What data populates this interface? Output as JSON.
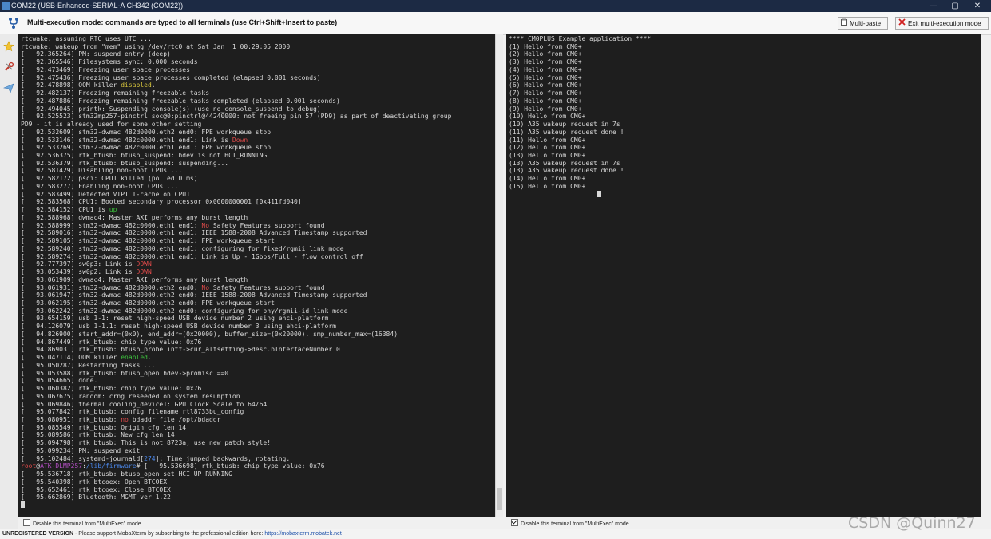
{
  "window": {
    "title": "COM22  (USB-Enhanced-SERIAL-A CH342 (COM22))",
    "minimize_symbol": "—",
    "maximize_symbol": "▢",
    "close_symbol": "✕"
  },
  "banner": {
    "message": "Multi-execution mode: commands are typed to all terminals (use Ctrl+Shift+Insert to paste)",
    "multipaste_label": "Multi-paste",
    "exit_label": "Exit multi-execution mode",
    "icon": "fork-icon"
  },
  "sidebar": {
    "items": [
      {
        "icon": "star-icon"
      },
      {
        "icon": "tools-icon"
      },
      {
        "icon": "send-icon"
      }
    ]
  },
  "left_terminal": {
    "lines": [
      [
        {
          "t": "rtcwake: assuming RTC uses UTC ..."
        }
      ],
      [
        {
          "t": "rtcwake: wakeup from \"mem\" using /dev/rtc0 at Sat Jan  1 00:29:05 2000"
        }
      ],
      [
        {
          "t": "[   92.365264] PM: suspend entry (deep)"
        }
      ],
      [
        {
          "t": "[   92.365546] Filesystems sync: 0.000 seconds"
        }
      ],
      [
        {
          "t": "[   92.473469] Freezing user space processes"
        }
      ],
      [
        {
          "t": "[   92.475436] Freezing user space processes completed (elapsed 0.001 seconds)"
        }
      ],
      [
        {
          "t": "[   92.478898] OOM killer "
        },
        {
          "t": "disabled",
          "c": "yellow"
        },
        {
          "t": "."
        }
      ],
      [
        {
          "t": "[   92.482137] Freezing remaining freezable tasks"
        }
      ],
      [
        {
          "t": "[   92.487886] Freezing remaining freezable tasks completed (elapsed 0.001 seconds)"
        }
      ],
      [
        {
          "t": "[   92.494045] printk: Suspending console(s) (use no_console_suspend to debug)"
        }
      ],
      [
        {
          "t": "[   92.525523] stm32mp257-pinctrl soc@0:pinctrl@44240000: not freeing pin 57 (PD9) as part of deactivating group"
        }
      ],
      [
        {
          "t": "PD9 - it is already used for some other setting"
        }
      ],
      [
        {
          "t": "[   92.532609] stm32-dwmac 482d0000.eth2 end0: FPE workqueue stop"
        }
      ],
      [
        {
          "t": "[   92.533146] stm32-dwmac 482c0000.eth1 end1: Link is "
        },
        {
          "t": "Down",
          "c": "red"
        }
      ],
      [
        {
          "t": "[   92.533269] stm32-dwmac 482c0000.eth1 end1: FPE workqueue stop"
        }
      ],
      [
        {
          "t": "[   92.536375] rtk_btusb: btusb_suspend: hdev is not HCI_RUNNING"
        }
      ],
      [
        {
          "t": "[   92.536379] rtk_btusb: btusb_suspend: suspending..."
        }
      ],
      [
        {
          "t": "[   92.581429] Disabling non-boot CPUs ..."
        }
      ],
      [
        {
          "t": "[   92.582172] psci: CPU1 killed (polled 0 ms)"
        }
      ],
      [
        {
          "t": "[   92.583277] Enabling non-boot CPUs ..."
        }
      ],
      [
        {
          "t": "[   92.583499] Detected VIPT I-cache on CPU1"
        }
      ],
      [
        {
          "t": "[   92.583568] CPU1: Booted secondary processor 0x0000000001 [0x411fd040]"
        }
      ],
      [
        {
          "t": "[   92.584152] CPU1 is "
        },
        {
          "t": "up",
          "c": "green"
        }
      ],
      [
        {
          "t": "[   92.588968] dwmac4: Master AXI performs any burst length"
        }
      ],
      [
        {
          "t": "[   92.588999] stm32-dwmac 482c0000.eth1 end1: "
        },
        {
          "t": "No",
          "c": "red"
        },
        {
          "t": " Safety Features support found"
        }
      ],
      [
        {
          "t": "[   92.589016] stm32-dwmac 482c0000.eth1 end1: IEEE 1588-2008 Advanced Timestamp supported"
        }
      ],
      [
        {
          "t": "[   92.589105] stm32-dwmac 482c0000.eth1 end1: FPE workqueue start"
        }
      ],
      [
        {
          "t": "[   92.589240] stm32-dwmac 482c0000.eth1 end1: configuring for fixed/rgmii link mode"
        }
      ],
      [
        {
          "t": "[   92.589274] stm32-dwmac 482c0000.eth1 end1: Link is Up - 1Gbps/Full - flow control off"
        }
      ],
      [
        {
          "t": "[   92.777397] sw0p3: Link is "
        },
        {
          "t": "DOWN",
          "c": "red"
        }
      ],
      [
        {
          "t": "[   93.053439] sw0p2: Link is "
        },
        {
          "t": "DOWN",
          "c": "red"
        }
      ],
      [
        {
          "t": "[   93.061909] dwmac4: Master AXI performs any burst length"
        }
      ],
      [
        {
          "t": "[   93.061931] stm32-dwmac 482d0000.eth2 end0: "
        },
        {
          "t": "No",
          "c": "red"
        },
        {
          "t": " Safety Features support found"
        }
      ],
      [
        {
          "t": "[   93.061947] stm32-dwmac 482d0000.eth2 end0: IEEE 1588-2008 Advanced Timestamp supported"
        }
      ],
      [
        {
          "t": "[   93.062195] stm32-dwmac 482d0000.eth2 end0: FPE workqueue start"
        }
      ],
      [
        {
          "t": "[   93.062242] stm32-dwmac 482d0000.eth2 end0: configuring for phy/rgmii-id link mode"
        }
      ],
      [
        {
          "t": "[   93.654159] usb 1-1: reset high-speed USB device number 2 using ehci-platform"
        }
      ],
      [
        {
          "t": "[   94.126079] usb 1-1.1: reset high-speed USB device number 3 using ehci-platform"
        }
      ],
      [
        {
          "t": "[   94.826900] start_addr=(0x0), end_addr=(0x20000), buffer_size=(0x20000), smp_number_max=(16384)"
        }
      ],
      [
        {
          "t": "[   94.867449] rtk_btusb: chip type value: 0x76"
        }
      ],
      [
        {
          "t": "[   94.869031] rtk_btusb: btusb_probe intf->cur_altsetting->desc.bInterfaceNumber 0"
        }
      ],
      [
        {
          "t": "[   95.047114] OOM killer "
        },
        {
          "t": "enabled",
          "c": "green"
        },
        {
          "t": "."
        }
      ],
      [
        {
          "t": "[   95.050287] Restarting tasks ..."
        }
      ],
      [
        {
          "t": "[   95.053588] rtk_btusb: btusb_open hdev->promisc ==0"
        }
      ],
      [
        {
          "t": "[   95.054665] done."
        }
      ],
      [
        {
          "t": "[   95.060382] rtk_btusb: chip type value: 0x76"
        }
      ],
      [
        {
          "t": "[   95.067675] random: crng reseeded on system resumption"
        }
      ],
      [
        {
          "t": "[   95.069846] thermal cooling_device1: GPU Clock Scale to 64/64"
        }
      ],
      [
        {
          "t": "[   95.077842] rtk_btusb: config filename rtl8733bu_config"
        }
      ],
      [
        {
          "t": "[   95.080951] rtk_btusb: "
        },
        {
          "t": "no",
          "c": "red"
        },
        {
          "t": " bdaddr file /opt/bdaddr"
        }
      ],
      [
        {
          "t": "[   95.085549] rtk_btusb: Origin cfg len 14"
        }
      ],
      [
        {
          "t": "[   95.089586] rtk_btusb: New cfg len 14"
        }
      ],
      [
        {
          "t": "[   95.094798] rtk_btusb: This is not 8723a, use new patch style!"
        }
      ],
      [
        {
          "t": "[   95.099234] PM: suspend exit"
        }
      ],
      [
        {
          "t": "[   95.102484] systemd-journald["
        },
        {
          "t": "274",
          "c": "blue"
        },
        {
          "t": "]: Time jumped backwards, rotating."
        }
      ],
      [
        {
          "t": "root",
          "c": "red"
        },
        {
          "t": "@"
        },
        {
          "t": "ATK-DLMP257",
          "c": "purple"
        },
        {
          "t": ":"
        },
        {
          "t": "/lib/firmware",
          "c": "blue"
        },
        {
          "t": "# [   95.536698] rtk_btusb: chip type value: 0x76"
        }
      ],
      [
        {
          "t": "[   95.536718] rtk_btusb: btusb_open set HCI UP RUNNING"
        }
      ],
      [
        {
          "t": "[   95.540398] rtk_btcoex: Open BTCOEX"
        }
      ],
      [
        {
          "t": "[   95.652461] rtk_btcoex: Close BTCOEX"
        }
      ],
      [
        {
          "t": "[   95.662869] Bluetooth: MGMT ver 1.22"
        }
      ]
    ],
    "disable_label": "Disable this terminal from \"MultiExec\" mode",
    "disabled": false
  },
  "right_terminal": {
    "lines": [
      [
        {
          "t": "**** CM0PLUS Example application ****"
        }
      ],
      [
        {
          "t": "(1) Hello from CM0+"
        }
      ],
      [
        {
          "t": "(2) Hello from CM0+"
        }
      ],
      [
        {
          "t": "(3) Hello from CM0+"
        }
      ],
      [
        {
          "t": "(4) Hello from CM0+"
        }
      ],
      [
        {
          "t": "(5) Hello from CM0+"
        }
      ],
      [
        {
          "t": "(6) Hello from CM0+"
        }
      ],
      [
        {
          "t": "(7) Hello from CM0+"
        }
      ],
      [
        {
          "t": "(8) Hello from CM0+"
        }
      ],
      [
        {
          "t": "(9) Hello from CM0+"
        }
      ],
      [
        {
          "t": "(10) Hello from CM0+"
        }
      ],
      [
        {
          "t": "(10) A35 wakeup request in 7s"
        }
      ],
      [
        {
          "t": "(11) A35 wakeup request done !"
        }
      ],
      [
        {
          "t": "(11) Hello from CM0+"
        }
      ],
      [
        {
          "t": "(12) Hello from CM0+"
        }
      ],
      [
        {
          "t": "(13) Hello from CM0+"
        }
      ],
      [
        {
          "t": "(13) A35 wakeup request in 7s"
        }
      ],
      [
        {
          "t": "(13) A35 wakeup request done !"
        }
      ],
      [
        {
          "t": "(14) Hello from CM0+"
        }
      ],
      [
        {
          "t": "(15) Hello from CM0+"
        }
      ]
    ],
    "disable_label": "Disable this terminal from \"MultiExec\" mode",
    "disabled": true
  },
  "statusbar": {
    "version": "UNREGISTERED VERSION",
    "message": "  -  Please support MobaXterm by subscribing to the professional edition here: ",
    "link": "https://mobaxterm.mobatek.net"
  },
  "watermark": "CSDN @Quinn27",
  "colors": {
    "terminal_bg": "#1e1e1e",
    "terminal_fg": "#d8d8d8",
    "red": "#e04a4a",
    "green": "#3dc23d",
    "yellow": "#d6c43c",
    "blue": "#4a86e8",
    "purple": "#b04ec0",
    "titlebar_bg": "#1c2a44"
  }
}
